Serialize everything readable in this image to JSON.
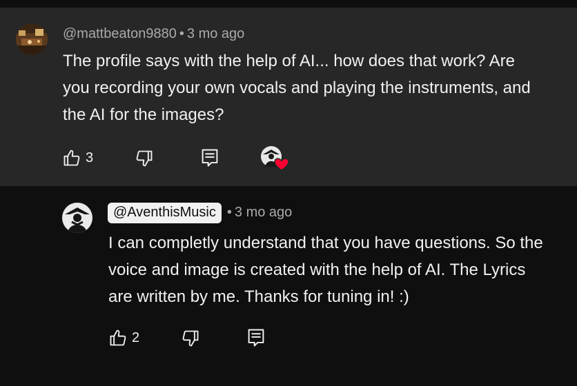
{
  "comment": {
    "handle": "@mattbeaton9880",
    "separator": "•",
    "time": "3 mo ago",
    "text": "The profile says with the help of AI... how does that work? Are you recording your own vocals and playing the instruments, and the AI for the images?",
    "like_count": "3",
    "like_icon": "thumbs-up-icon",
    "dislike_icon": "thumbs-down-icon",
    "reply_icon": "reply-icon",
    "creator_heart_icon": "creator-heart-icon"
  },
  "reply": {
    "handle": "@AventhisMusic",
    "separator": "•",
    "time": "3 mo ago",
    "text": "I can completly understand that you have questions. So the voice and image is created with the help of AI. The Lyrics are written by me. Thanks for tuning in! :)",
    "like_count": "2",
    "like_icon": "thumbs-up-icon",
    "dislike_icon": "thumbs-down-icon",
    "reply_icon": "reply-icon"
  },
  "colors": {
    "background": "#0f0f0f",
    "highlight_background": "#272727",
    "text": "#f1f1f1",
    "meta_text": "#aaaaaa",
    "heart": "#ff0033",
    "handle_pill": "#f1f1f1"
  }
}
